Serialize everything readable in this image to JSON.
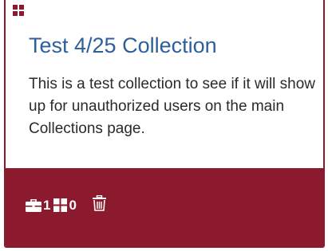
{
  "card": {
    "title": "Test 4/25 Collection",
    "description": "This is a test collection to see if it will show up for unauthorized users on the main Collections page.",
    "type_icon": "grid-icon",
    "stats": {
      "items_icon": "briefcase-icon",
      "items_count": "1",
      "collections_icon": "grid-icon",
      "collections_count": "0",
      "delete_icon": "trash-icon"
    },
    "colors": {
      "brand": "#8b1a2f",
      "title": "#2d5f9a",
      "text": "#2a2a2a"
    }
  }
}
